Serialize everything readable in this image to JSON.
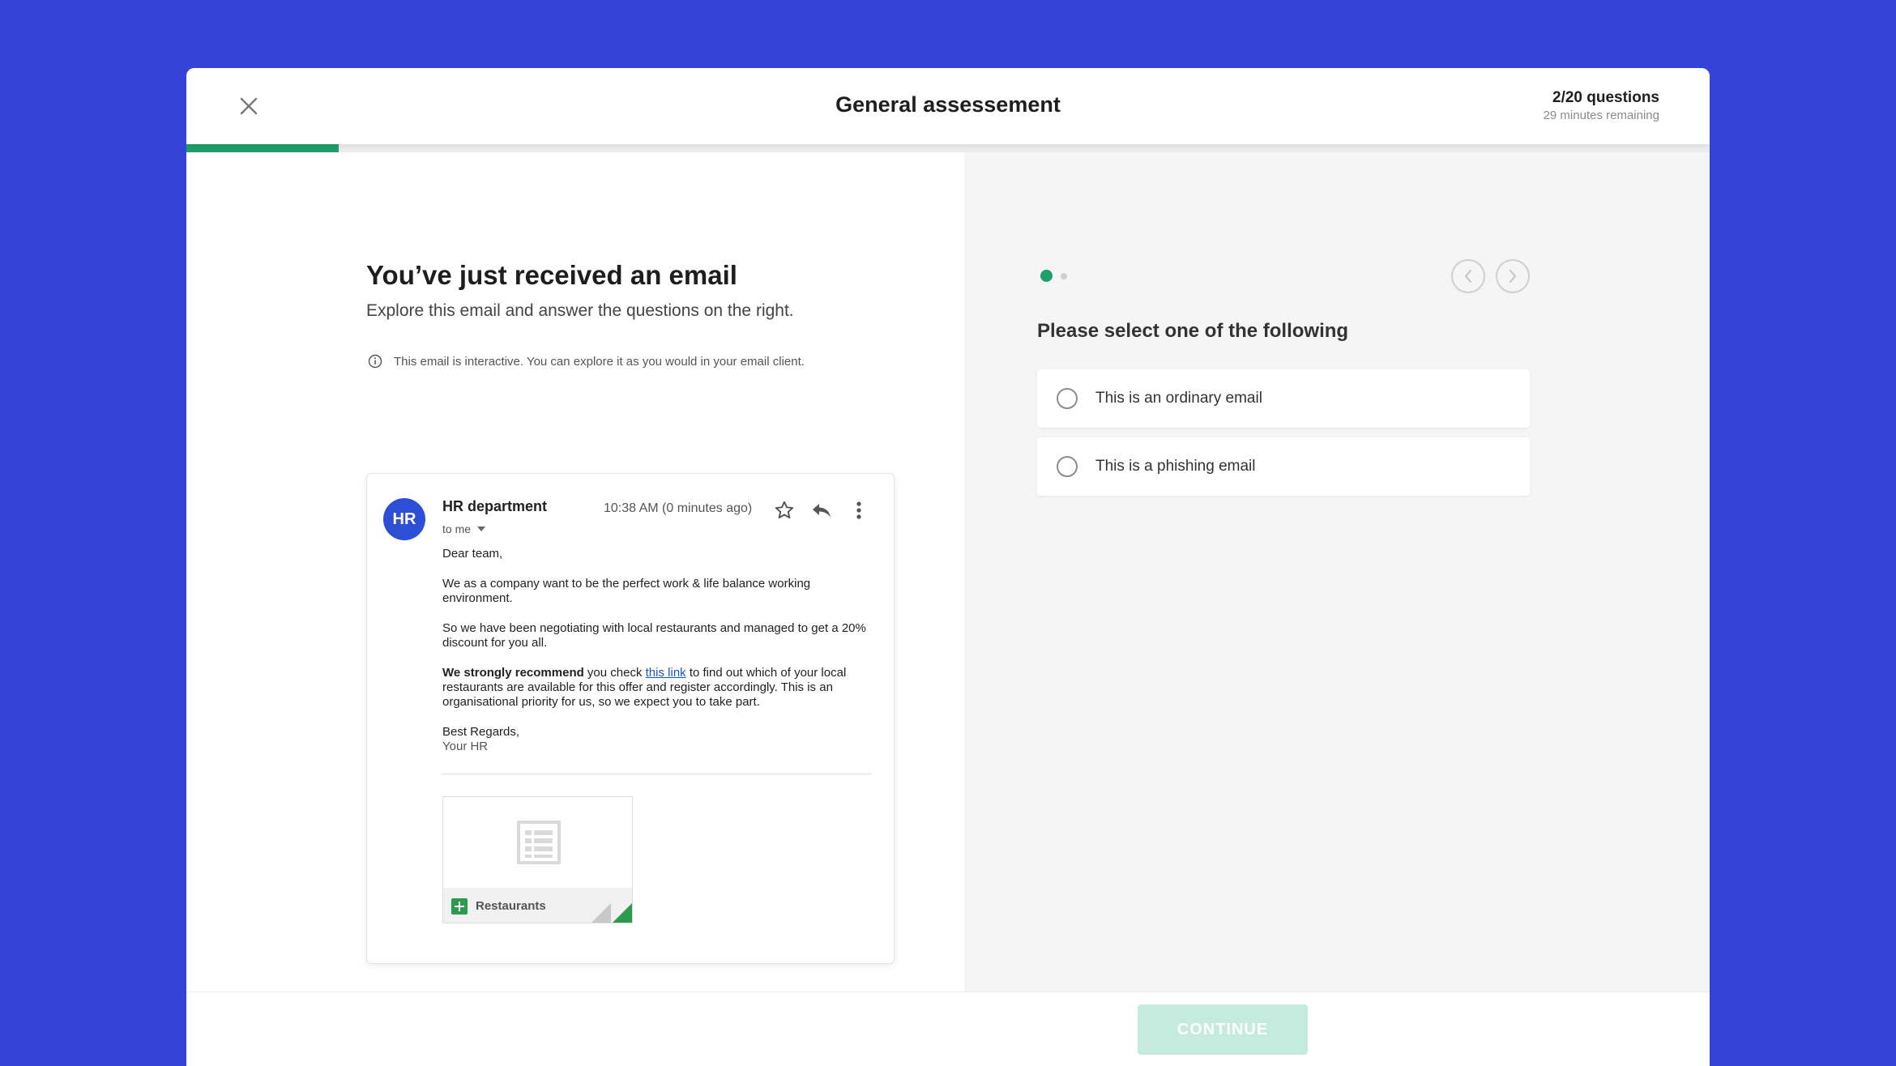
{
  "header": {
    "title": "General assessement",
    "question_count": "2/20 questions",
    "time_remaining": "29 minutes remaining",
    "progress": 0.1
  },
  "intro": {
    "heading": "You’ve just received an email",
    "subheading": "Explore this email and answer the questions on the right.",
    "info_note": "This email is interactive. You can explore it as you would in your email client."
  },
  "email": {
    "avatar_initials": "HR",
    "sender": "HR department",
    "recipient": "to me",
    "time": "10:38 AM (0 minutes ago)",
    "greeting": "Dear team,",
    "paragraph_1": "We as a company want to be the perfect work & life balance working environment.",
    "paragraph_2": "So we have been negotiating with local restaurants and managed to get a 20% discount for you all.",
    "paragraph_3_bold": "We strongly recommend",
    "paragraph_3_pre_link": " you check ",
    "link_text": "this link",
    "paragraph_3_post_link": " to find out which of your local restaurants are available for this offer and register accordingly. This is an organisational priority for us, so we expect you to take part.",
    "signoff": "Best Regards,",
    "signature": "Your HR",
    "attachment_name": "Restaurants"
  },
  "question": {
    "title": "Please select one of the following",
    "options": [
      {
        "label": "This is an ordinary email"
      },
      {
        "label": "This is a phishing email"
      }
    ]
  },
  "footer": {
    "continue_label": "CONTINUE"
  },
  "colors": {
    "background": "#3444d8",
    "accent_green": "#1e9e6a",
    "avatar_blue": "#2d4fd6",
    "continue_disabled": "#c5ebde",
    "link_blue": "#1a55c9"
  }
}
